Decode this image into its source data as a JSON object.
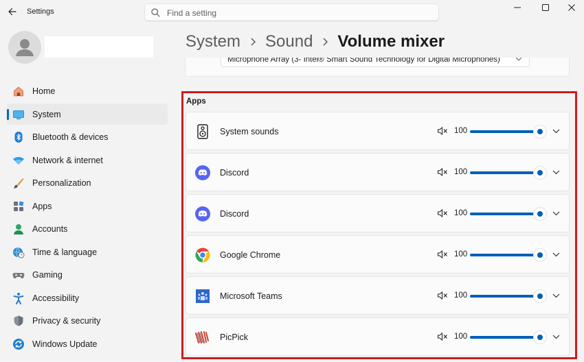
{
  "window": {
    "title": "Settings",
    "search_placeholder": "Find a setting"
  },
  "sidebar": {
    "items": [
      {
        "label": "Home",
        "icon": "home-icon",
        "active": false
      },
      {
        "label": "System",
        "icon": "system-icon",
        "active": true
      },
      {
        "label": "Bluetooth & devices",
        "icon": "bluetooth-icon",
        "active": false
      },
      {
        "label": "Network & internet",
        "icon": "wifi-icon",
        "active": false
      },
      {
        "label": "Personalization",
        "icon": "brush-icon",
        "active": false
      },
      {
        "label": "Apps",
        "icon": "apps-icon",
        "active": false
      },
      {
        "label": "Accounts",
        "icon": "accounts-icon",
        "active": false
      },
      {
        "label": "Time & language",
        "icon": "globe-clock-icon",
        "active": false
      },
      {
        "label": "Gaming",
        "icon": "gamepad-icon",
        "active": false
      },
      {
        "label": "Accessibility",
        "icon": "accessibility-icon",
        "active": false
      },
      {
        "label": "Privacy & security",
        "icon": "shield-icon",
        "active": false
      },
      {
        "label": "Windows Update",
        "icon": "update-icon",
        "active": false
      }
    ]
  },
  "breadcrumb": [
    "System",
    "Sound",
    "Volume mixer"
  ],
  "input_device": {
    "selected": "Microphone Array (3- Intel® Smart Sound Technology for Digital Microphones)"
  },
  "apps_section": {
    "title": "Apps",
    "apps": [
      {
        "name": "System sounds",
        "icon": "speaker-icon",
        "volume": 100
      },
      {
        "name": "Discord",
        "icon": "discord-icon",
        "volume": 100
      },
      {
        "name": "Discord",
        "icon": "discord-icon",
        "volume": 100
      },
      {
        "name": "Google Chrome",
        "icon": "chrome-icon",
        "volume": 100
      },
      {
        "name": "Microsoft Teams",
        "icon": "teams-icon",
        "volume": 100
      },
      {
        "name": "PicPick",
        "icon": "picpick-icon",
        "volume": 100
      }
    ]
  },
  "colors": {
    "accent": "#005fb8",
    "highlight_border": "#d01c1c"
  }
}
